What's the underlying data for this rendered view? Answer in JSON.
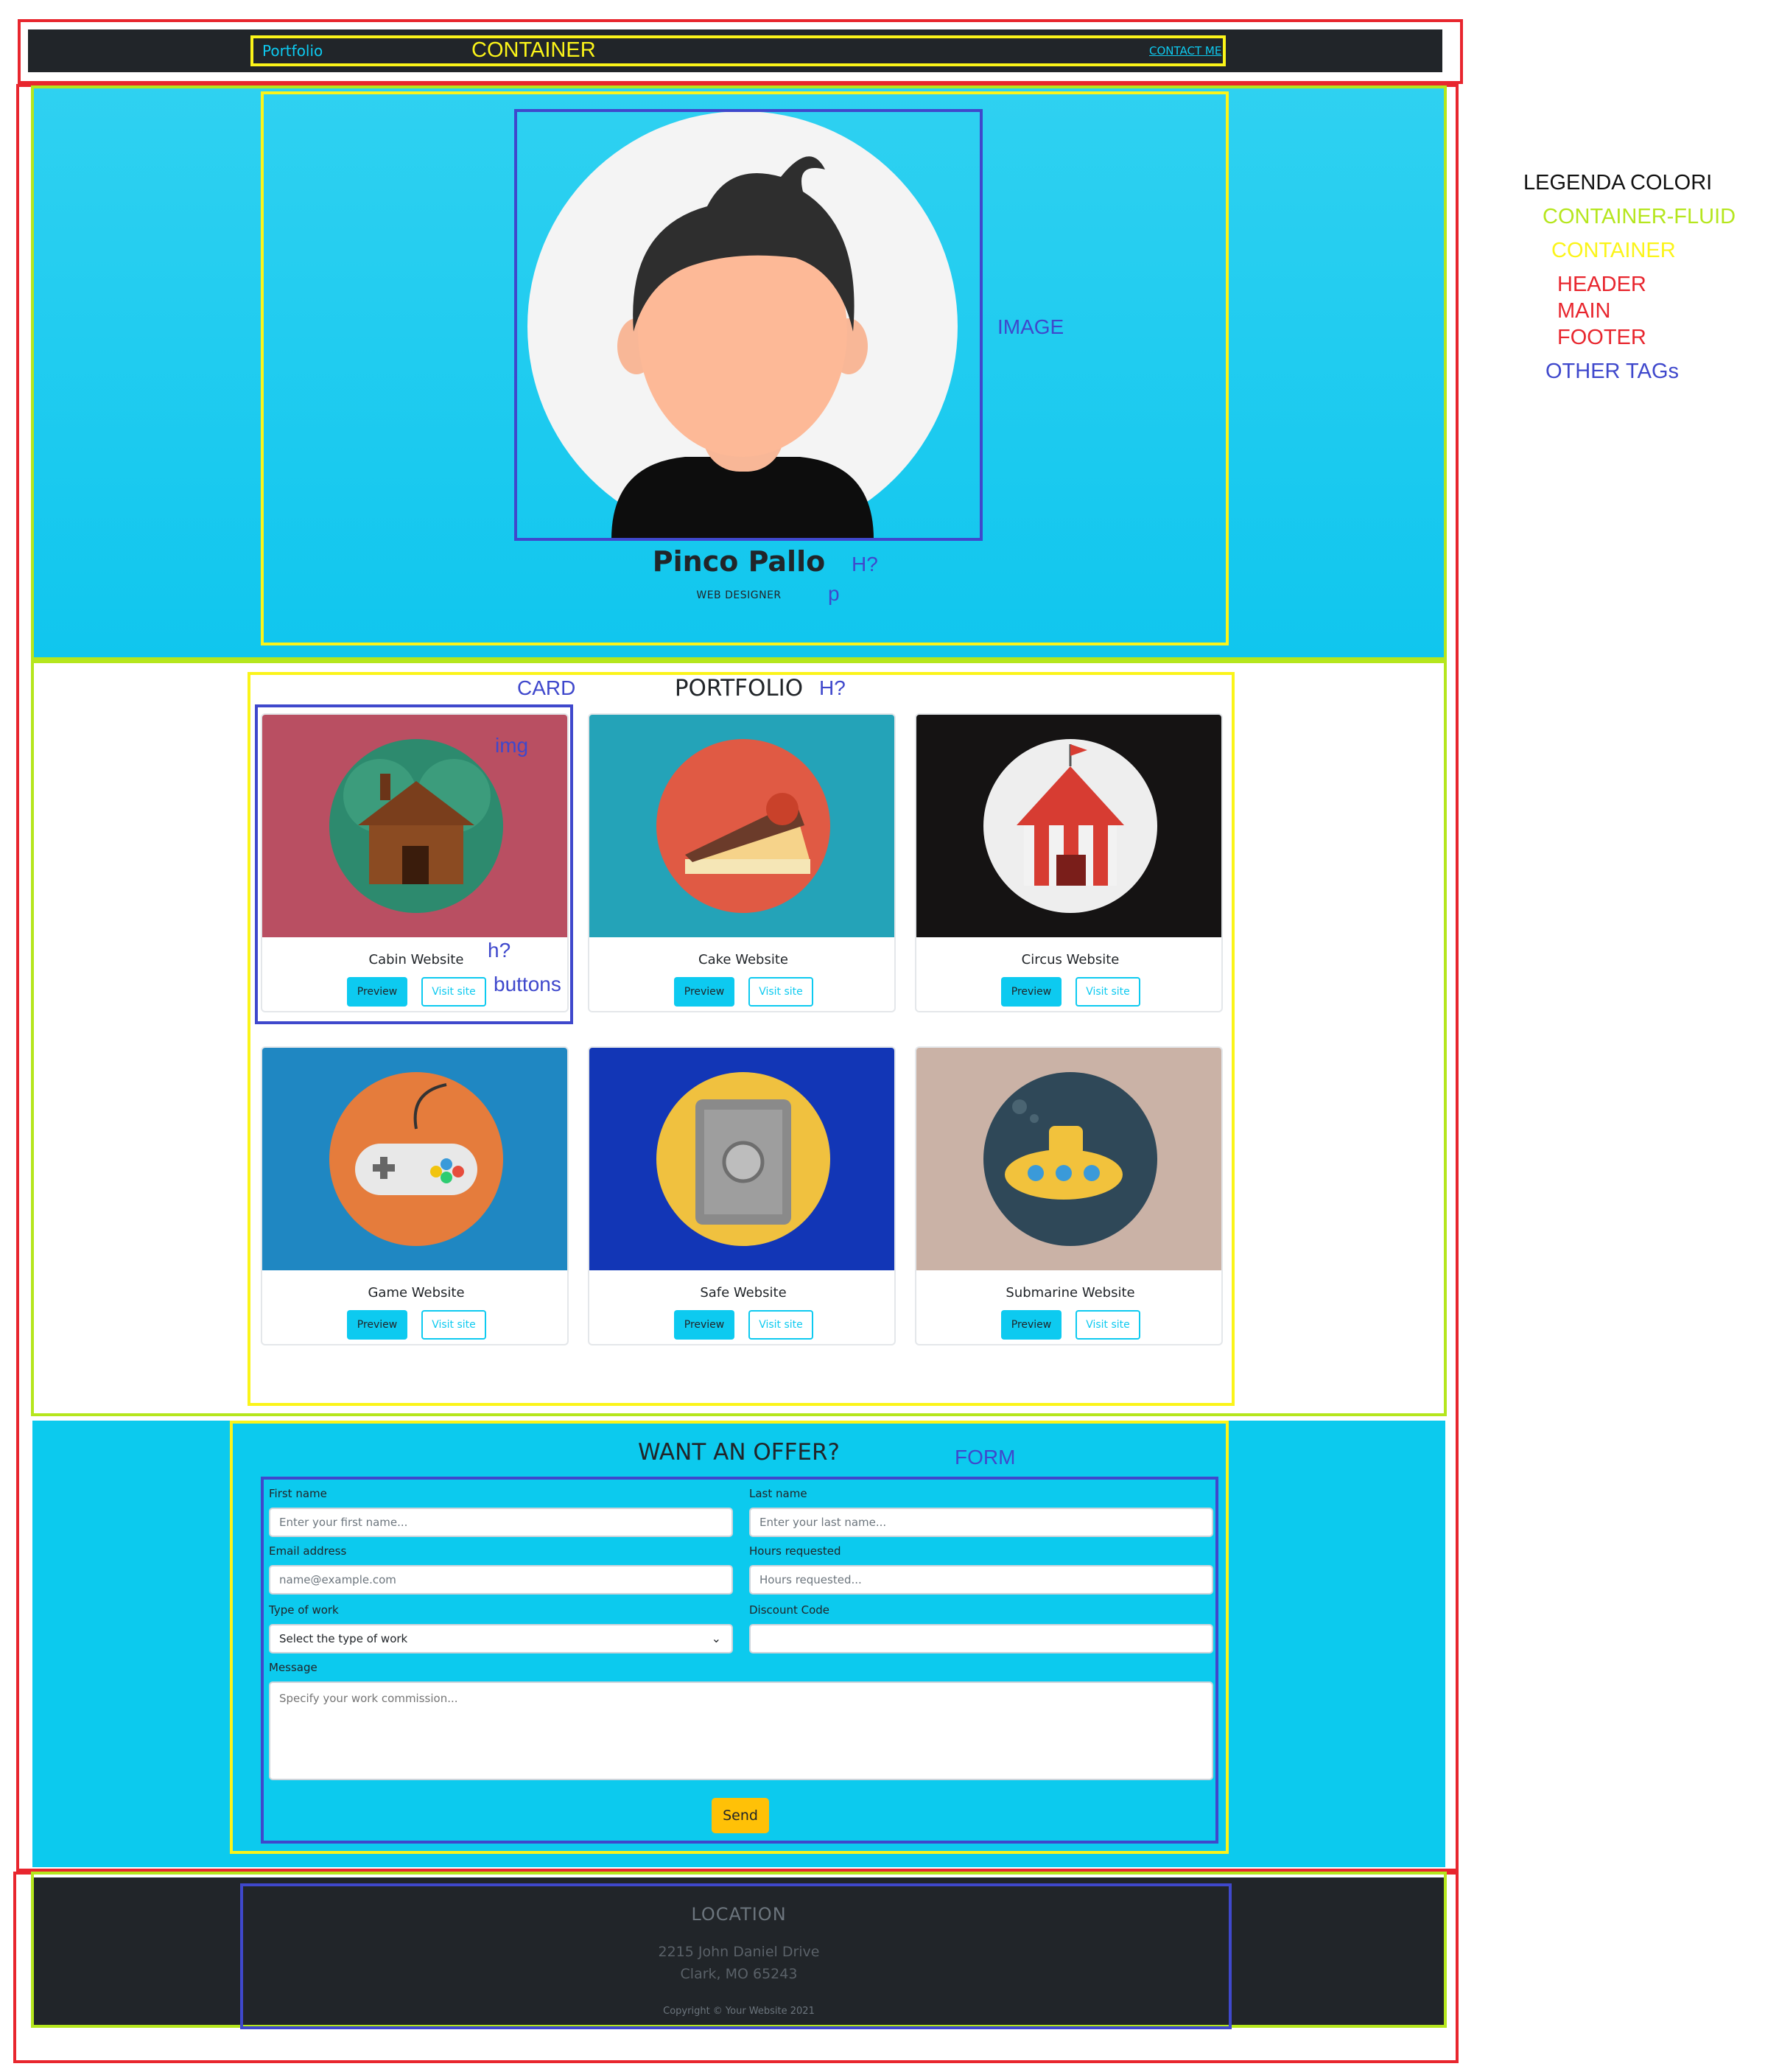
{
  "header": {
    "brand": "Portfolio",
    "container_label": "CONTAINER",
    "contact_link": "CONTACT ME"
  },
  "hero": {
    "name": "Pinco Pallo",
    "role": "WEB DESIGNER"
  },
  "portfolio": {
    "title": "PORTFOLIO",
    "cards": [
      {
        "title": "Cabin Website",
        "preview": "Preview",
        "visit": "Visit site",
        "bg": "#b94f62",
        "circle": "#2d8a6e",
        "icon": "cabin-icon"
      },
      {
        "title": "Cake Website",
        "preview": "Preview",
        "visit": "Visit site",
        "bg": "#24a3b8",
        "circle": "#e05a44",
        "icon": "cake-icon"
      },
      {
        "title": "Circus Website",
        "preview": "Preview",
        "visit": "Visit site",
        "bg": "#151313",
        "circle": "#eeeeee",
        "icon": "circus-tent-icon"
      },
      {
        "title": "Game Website",
        "preview": "Preview",
        "visit": "Visit site",
        "bg": "#1f87c2",
        "circle": "#e57c3c",
        "icon": "gamepad-icon"
      },
      {
        "title": "Safe Website",
        "preview": "Preview",
        "visit": "Visit site",
        "bg": "#1236b6",
        "circle": "#f0c13f",
        "icon": "safe-icon"
      },
      {
        "title": "Submarine Website",
        "preview": "Preview",
        "visit": "Visit site",
        "bg": "#cab2a6",
        "circle": "#2f4858",
        "icon": "submarine-icon"
      }
    ]
  },
  "form": {
    "title": "WANT AN OFFER?",
    "first_name_label": "First name",
    "first_name_placeholder": "Enter your first name...",
    "last_name_label": "Last name",
    "last_name_placeholder": "Enter your last name...",
    "email_label": "Email address",
    "email_placeholder": "name@example.com",
    "hours_label": "Hours requested",
    "hours_placeholder": "Hours requested...",
    "work_label": "Type of work",
    "work_value": "Select the type of work",
    "discount_label": "Discount Code",
    "message_label": "Message",
    "message_placeholder": "Specify your work commission...",
    "send": "Send"
  },
  "footer": {
    "title": "LOCATION",
    "address_line1": "2215 John Daniel Drive",
    "address_line2": "Clark, MO 65243",
    "copyright": "Copyright © Your Website 2021"
  },
  "annotations": {
    "image": "IMAGE",
    "h_q": "H?",
    "p": "p",
    "card": "CARD",
    "img": "img",
    "h_small": "h?",
    "buttons": "buttons",
    "form": "FORM"
  },
  "legend": {
    "title": "LEGENDA COLORI",
    "container_fluid": "CONTAINER-FLUID",
    "container": "CONTAINER",
    "header": "HEADER",
    "main": "MAIN",
    "footer": "FOOTER",
    "other": "OTHER TAGs"
  },
  "colors": {
    "accent": "#0dcaf0",
    "dark": "#212529",
    "send": "#ffc107",
    "red": "#e8262e",
    "lime": "#b5e61d",
    "yellow": "#fbf419",
    "blue": "#3f48cc"
  }
}
